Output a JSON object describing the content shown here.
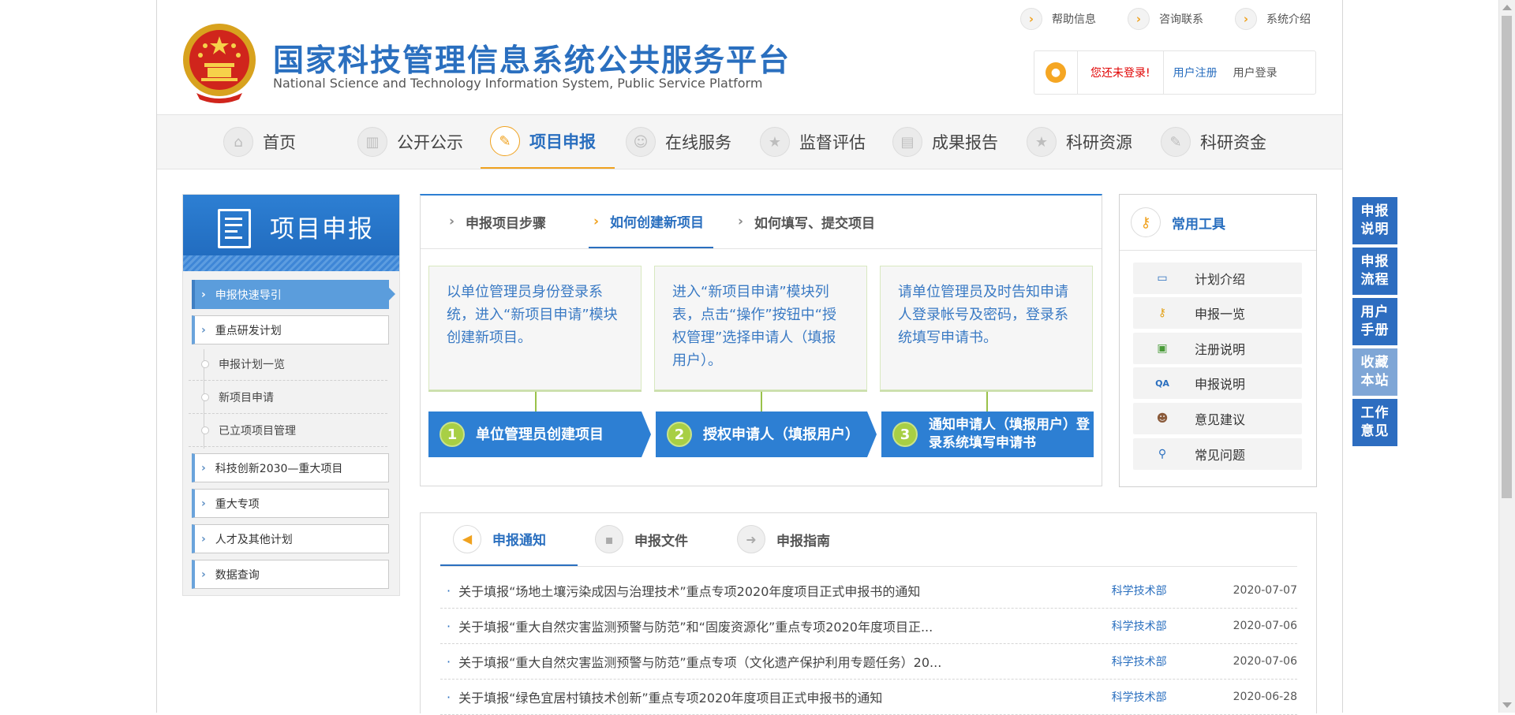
{
  "header": {
    "title": "国家科技管理信息系统公共服务平台",
    "subtitle": "National Science and Technology Information System, Public Service Platform",
    "toplinks": [
      {
        "label": "帮助信息"
      },
      {
        "label": "咨询联系"
      },
      {
        "label": "系统介绍"
      }
    ],
    "login": {
      "status": "您还未登录!",
      "register": "用户注册",
      "login": "用户登录"
    }
  },
  "nav": [
    {
      "label": "首页",
      "icon": "home-icon"
    },
    {
      "label": "公开公示",
      "icon": "bar-chart-icon"
    },
    {
      "label": "项目申报",
      "icon": "pencil-icon",
      "active": true
    },
    {
      "label": "在线服务",
      "icon": "headset-icon"
    },
    {
      "label": "监督评估",
      "icon": "star-icon"
    },
    {
      "label": "成果报告",
      "icon": "report-icon"
    },
    {
      "label": "科研资源",
      "icon": "star-icon"
    },
    {
      "label": "科研资金",
      "icon": "pen-icon"
    }
  ],
  "sidebar": {
    "title": "项目申报",
    "items": [
      {
        "label": "申报快速导引",
        "active": true
      },
      {
        "label": "重点研发计划"
      }
    ],
    "subitems": [
      {
        "label": "申报计划一览"
      },
      {
        "label": "新项目申请"
      },
      {
        "label": "已立项项目管理"
      }
    ],
    "items2": [
      {
        "label": "科技创新2030—重大项目"
      },
      {
        "label": "重大专项"
      },
      {
        "label": "人才及其他计划"
      },
      {
        "label": "数据查询"
      }
    ]
  },
  "steps": {
    "tabs": [
      {
        "label": "申报项目步骤"
      },
      {
        "label": "如何创建新项目",
        "active": true
      },
      {
        "label": "如何填写、提交项目"
      }
    ],
    "cards": [
      {
        "text": "以单位管理员身份登录系统，进入“新项目申请”模块创建新项目。"
      },
      {
        "text": "进入“新项目申请”模块列表，点击“操作”按钮中“授权管理”选择申请人（填报用户）。"
      },
      {
        "text": "请单位管理员及时告知申请人登录帐号及密码，登录系统填写申请书。"
      }
    ],
    "flow": [
      {
        "num": "1",
        "label": "单位管理员创建项目"
      },
      {
        "num": "2",
        "label": "授权申请人（填报用户）"
      },
      {
        "num": "3",
        "label": "通知申请人（填报用户）登录系统填写申请书"
      }
    ]
  },
  "tools": {
    "title": "常用工具",
    "items": [
      {
        "label": "计划介绍",
        "icon": "monitor-icon"
      },
      {
        "label": "申报一览",
        "icon": "key-icon"
      },
      {
        "label": "注册说明",
        "icon": "id-card-icon"
      },
      {
        "label": "申报说明",
        "icon": "qa-icon"
      },
      {
        "label": "意见建议",
        "icon": "person-icon"
      },
      {
        "label": "常见问题",
        "icon": "magnifier-icon"
      }
    ]
  },
  "news": {
    "tabs": [
      {
        "label": "申报通知",
        "icon": "speaker-icon",
        "active": true
      },
      {
        "label": "申报文件",
        "icon": "briefcase-icon"
      },
      {
        "label": "申报指南",
        "icon": "signpost-icon"
      }
    ],
    "rows": [
      {
        "title": "关于填报“场地土壤污染成因与治理技术”重点专项2020年度项目正式申报书的通知",
        "dept": "科学技术部",
        "date": "2020-07-07"
      },
      {
        "title": "关于填报“重大自然灾害监测预警与防范”和“固废资源化”重点专项2020年度项目正...",
        "dept": "科学技术部",
        "date": "2020-07-06"
      },
      {
        "title": "关于填报“重大自然灾害监测预警与防范”重点专项（文化遗产保护利用专题任务）20...",
        "dept": "科学技术部",
        "date": "2020-07-06"
      },
      {
        "title": "关于填报“绿色宜居村镇技术创新”重点专项2020年度项目正式申报书的通知",
        "dept": "科学技术部",
        "date": "2020-06-28"
      }
    ]
  },
  "float": [
    {
      "label": "申报说明"
    },
    {
      "label": "申报流程"
    },
    {
      "label": "用户手册"
    },
    {
      "label": "收藏本站"
    },
    {
      "label": "工作意见"
    }
  ],
  "colors": {
    "brand": "#2a6fbf",
    "accent": "#f0a21f",
    "alert": "#e00000",
    "flow_green": "#a8cf45"
  }
}
